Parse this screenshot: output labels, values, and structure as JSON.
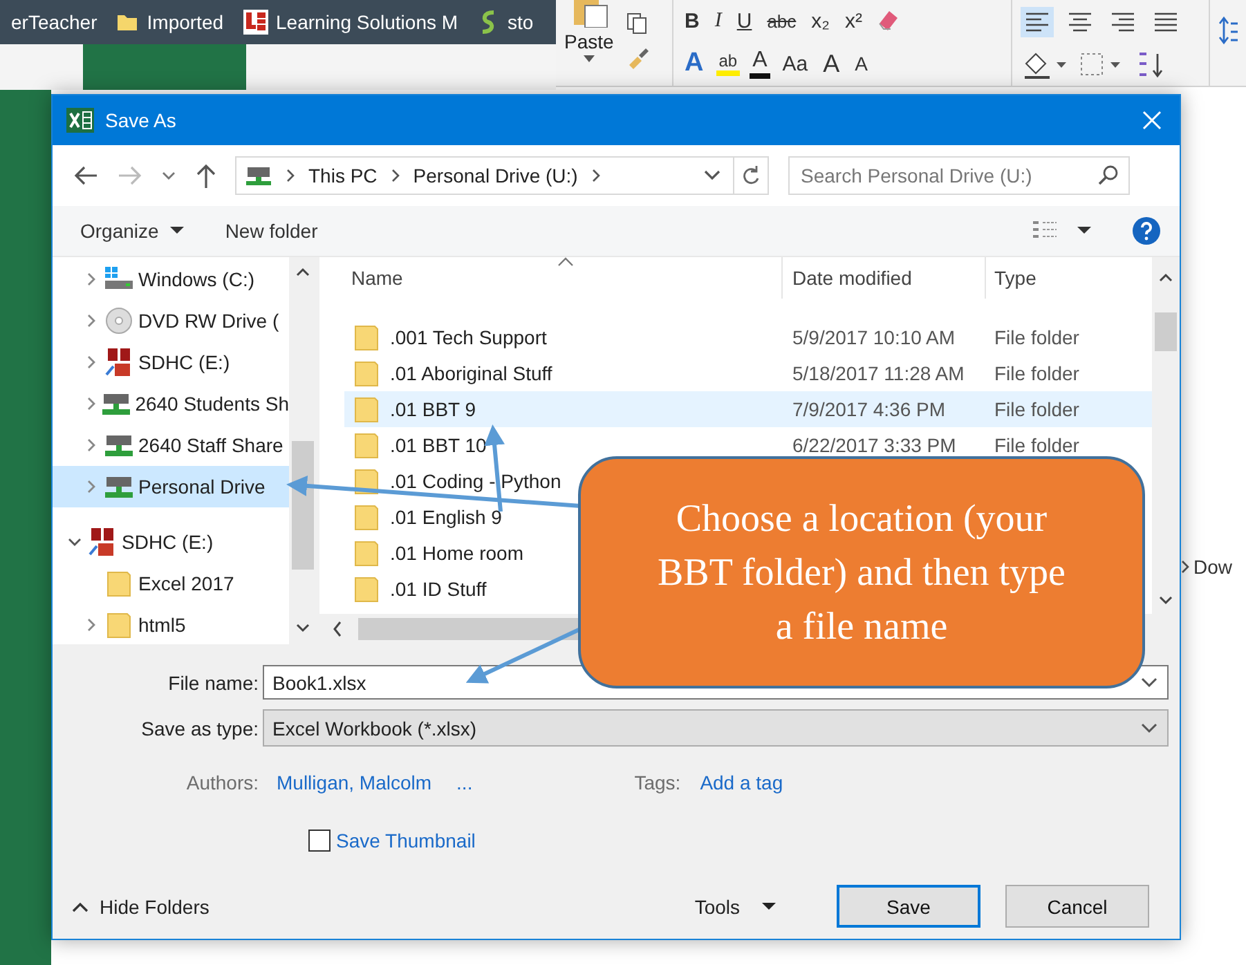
{
  "bookmarks": [
    {
      "label": "erTeacher",
      "kind": "plain"
    },
    {
      "label": "Imported",
      "kind": "folder"
    },
    {
      "label": "Learning Solutions M",
      "kind": "logo"
    },
    {
      "label": "sto",
      "kind": "app"
    }
  ],
  "ribbon": {
    "paste_label": "Paste",
    "font_row1": [
      {
        "label": "B",
        "kind": "bold"
      },
      {
        "label": "I",
        "kind": "italic"
      },
      {
        "label": "U",
        "kind": "underline"
      },
      {
        "label": "abc",
        "kind": "strike"
      },
      {
        "label": "x₂",
        "kind": "plain"
      },
      {
        "label": "x²",
        "kind": "plain"
      }
    ],
    "font_row2": [
      {
        "label": "A",
        "kind": "effect"
      },
      {
        "label": "ab",
        "kind": "highlight"
      },
      {
        "label": "A",
        "kind": "fontcolor"
      },
      {
        "label": "Aa",
        "kind": "plain"
      },
      {
        "label": "A",
        "kind": "grow"
      },
      {
        "label": "A",
        "kind": "shrink"
      }
    ]
  },
  "side_text": "Dow",
  "dialog": {
    "title": "Save As",
    "breadcrumb": [
      "This PC",
      "Personal Drive (U:)"
    ],
    "search": {
      "placeholder": "Search Personal Drive (U:)"
    },
    "toolbar": {
      "organize": "Organize",
      "new_folder": "New folder"
    },
    "nav": {
      "pc_children": [
        {
          "label": "Windows (C:)",
          "kind": "windows",
          "expandable": true,
          "expanded": false,
          "selected": false
        },
        {
          "label": "DVD RW Drive (",
          "kind": "dvd",
          "expandable": true,
          "expanded": false,
          "selected": false
        },
        {
          "label": "SDHC (E:)",
          "kind": "sd",
          "expandable": true,
          "expanded": false,
          "selected": false
        },
        {
          "label": "2640 Students Sh",
          "kind": "network",
          "expandable": true,
          "expanded": false,
          "selected": false
        },
        {
          "label": "2640 Staff Share",
          "kind": "network",
          "expandable": true,
          "expanded": false,
          "selected": false
        },
        {
          "label": "Personal Drive",
          "kind": "network",
          "expandable": true,
          "expanded": false,
          "selected": true
        }
      ],
      "roots": [
        {
          "label": "SDHC (E:)",
          "kind": "sd",
          "expanded": true,
          "selected": false,
          "children": [
            {
              "label": "Excel 2017",
              "kind": "folder",
              "expandable": false,
              "expanded": false,
              "selected": false
            },
            {
              "label": "html5",
              "kind": "folder",
              "expandable": true,
              "expanded": false,
              "selected": false
            }
          ]
        }
      ]
    },
    "columns": [
      "Name",
      "Date modified",
      "Type"
    ],
    "rows": [
      {
        "name": ".001 Tech Support",
        "date": "5/9/2017 10:10 AM",
        "type": "File folder",
        "selected": false
      },
      {
        "name": ".01 Aboriginal Stuff",
        "date": "5/18/2017 11:28 AM",
        "type": "File folder",
        "selected": false
      },
      {
        "name": ".01 BBT 9",
        "date": "7/9/2017 4:36 PM",
        "type": "File folder",
        "selected": true
      },
      {
        "name": ".01 BBT 10",
        "date": "6/22/2017 3:33 PM",
        "type": "File folder",
        "selected": false
      },
      {
        "name": ".01 Coding - Python",
        "selected": false
      },
      {
        "name": ".01 English 9",
        "selected": false
      },
      {
        "name": ".01 Home room",
        "selected": false
      },
      {
        "name": ".01 ID Stuff",
        "selected": false
      }
    ],
    "file_name_label": "File name:",
    "file_name": "Book1.xlsx",
    "type_label": "Save as type:",
    "save_type": "Excel Workbook (*.xlsx)",
    "authors_label": "Authors:",
    "author": "Mulligan, Malcolm",
    "more": "...",
    "tags_label": "Tags:",
    "tags_placeholder": "Add a tag",
    "save_thumbnail": {
      "label": "Save Thumbnail",
      "checked": false
    },
    "hide_folders": "Hide Folders",
    "tools": "Tools",
    "buttons": [
      {
        "label": "Save",
        "default": true
      },
      {
        "label": "Cancel",
        "default": false
      }
    ]
  },
  "callout": {
    "text": "Choose a location (your BBT folder) and then type a file name"
  }
}
